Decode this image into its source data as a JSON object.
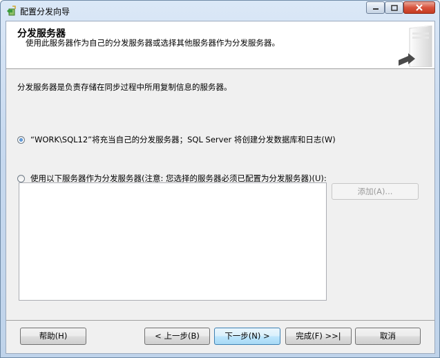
{
  "window": {
    "title": "配置分发向导",
    "controls": {
      "minimize": "‒",
      "maximize": "□",
      "close": "✕"
    }
  },
  "header": {
    "title": "分发服务器",
    "subtitle": "使用此服务器作为自己的分发服务器或选择其他服务器作为分发服务器。",
    "image_icon": "server-box-icon"
  },
  "main": {
    "description": "分发服务器是负责存储在同步过程中所用复制信息的服务器。",
    "options": [
      {
        "label": "“WORK\\SQL12”将充当自己的分发服务器；SQL Server 将创建分发数据库和日志(W)",
        "checked": true
      },
      {
        "label": "使用以下服务器作为分发服务器(注意: 您选择的服务器必须已配置为分发服务器)(U):",
        "checked": false
      }
    ],
    "server_list": [],
    "add_button": "添加(A)..."
  },
  "footer": {
    "help": "帮助(H)",
    "back": "< 上一步(B)",
    "next": "下一步(N) >",
    "finish": "完成(F) >>|",
    "cancel": "取消"
  },
  "colors": {
    "accent": "#2a6fc0",
    "close_button": "#c43b22"
  }
}
